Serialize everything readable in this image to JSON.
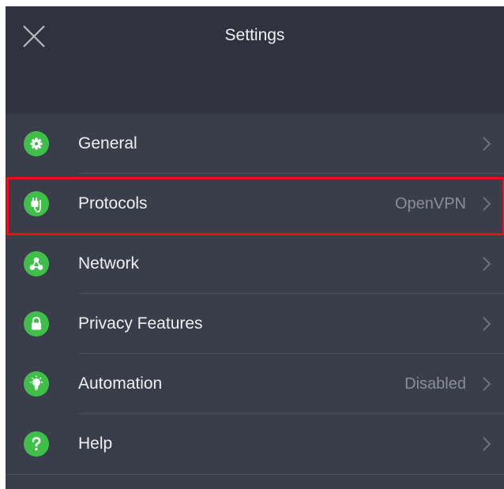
{
  "header": {
    "title": "Settings",
    "close_icon": "close-icon"
  },
  "menu": {
    "items": [
      {
        "label": "General",
        "value": "",
        "icon": "gear-icon"
      },
      {
        "label": "Protocols",
        "value": "OpenVPN",
        "icon": "plug-icon"
      },
      {
        "label": "Network",
        "value": "",
        "icon": "network-icon"
      },
      {
        "label": "Privacy Features",
        "value": "",
        "icon": "lock-icon"
      },
      {
        "label": "Automation",
        "value": "Disabled",
        "icon": "bulb-icon"
      },
      {
        "label": "Help",
        "value": "",
        "icon": "help-icon"
      }
    ],
    "highlighted_item": "Protocols"
  },
  "colors": {
    "header_bg": "#30333f",
    "panel_bg": "#3a3d4a",
    "icon_green": "#3fbf4a",
    "highlight_red": "#e8101c",
    "value_gray": "#8b8e99"
  }
}
